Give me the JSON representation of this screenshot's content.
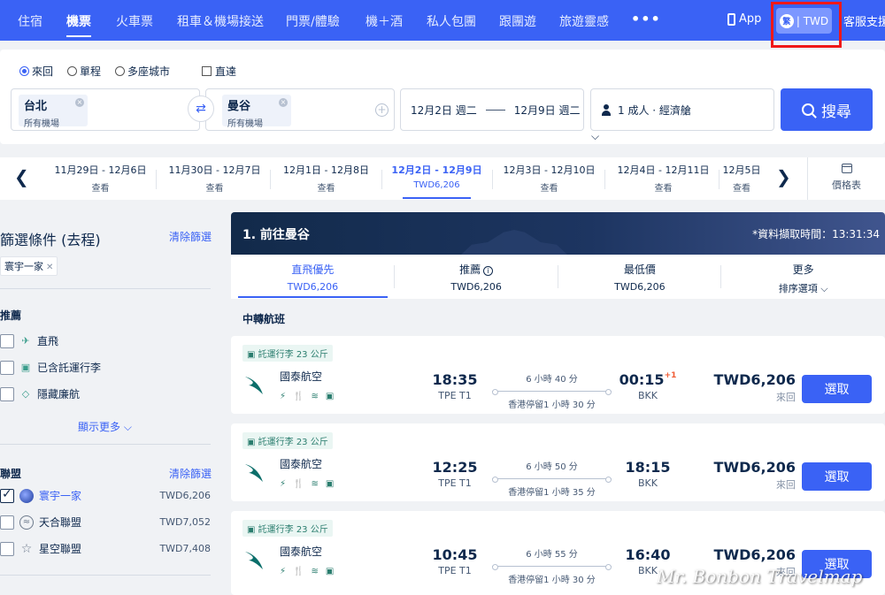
{
  "nav": {
    "items": [
      "住宿",
      "機票",
      "火車票",
      "租車＆機場接送",
      "門票/體驗",
      "機＋酒",
      "私人包團",
      "跟團遊",
      "旅遊靈感"
    ],
    "active_index": 1,
    "more_icon": "•••",
    "app_label": "App",
    "lang_badge": "繁",
    "currency_label": "| TWD",
    "support_label": "客服支援"
  },
  "search": {
    "trip_types": [
      "來回",
      "單程",
      "多座城市"
    ],
    "selected_trip_type": "來回",
    "direct_label": "直達",
    "origin": {
      "city": "台北",
      "sub": "所有機場"
    },
    "destination": {
      "city": "曼谷",
      "sub": "所有機場"
    },
    "depart_date": "12月2日 週二",
    "return_date": "12月9日 週二",
    "passengers": "1 成人 · 經濟艙",
    "search_label": "搜尋"
  },
  "date_strip": {
    "cells": [
      {
        "dates": "11月29日 - 12月6日",
        "price": "查看"
      },
      {
        "dates": "11月30日 - 12月7日",
        "price": "查看"
      },
      {
        "dates": "12月1日 - 12月8日",
        "price": "查看"
      },
      {
        "dates": "12月2日 - 12月9日",
        "price": "TWD6,206"
      },
      {
        "dates": "12月3日 - 12月10日",
        "price": "查看"
      },
      {
        "dates": "12月4日 - 12月11日",
        "price": "查看"
      },
      {
        "dates": "12月5日",
        "price": "查看"
      }
    ],
    "active_index": 3,
    "price_table_label": "價格表"
  },
  "sidebar": {
    "title": "篩選條件 (去程)",
    "clear_label": "清除篩選",
    "applied_tag": "寰宇一家",
    "recommended_heading": "推薦",
    "recommended": [
      {
        "label": "直飛",
        "icon": "plane-icon"
      },
      {
        "label": "已含託運行李",
        "icon": "luggage-icon"
      },
      {
        "label": "隱藏廉航",
        "icon": "tag-icon"
      }
    ],
    "show_more": "顯示更多",
    "alliance_heading": "聯盟",
    "alliance_clear": "清除篩選",
    "alliances": [
      {
        "label": "寰宇一家",
        "price": "TWD6,206",
        "checked": true,
        "color": "#3a62f5"
      },
      {
        "label": "天合聯盟",
        "price": "TWD7,052",
        "checked": false,
        "color": "#6d7a8c"
      },
      {
        "label": "星空聯盟",
        "price": "TWD7,408",
        "checked": false,
        "color": "#6d7a8c"
      }
    ]
  },
  "results": {
    "banner_title": "1. 前往曼谷",
    "fetch_time": "*資料擷取時間：13:31:34",
    "sort_tabs": [
      {
        "name": "直飛優先",
        "value": "TWD6,206"
      },
      {
        "name": "推薦",
        "value": "TWD6,206"
      },
      {
        "name": "最低價",
        "value": "TWD6,206"
      },
      {
        "name": "更多",
        "value": "排序選項"
      }
    ],
    "section_label": "中轉航班",
    "flights": [
      {
        "bag": "託運行李 23 公斤",
        "airline": "國泰航空",
        "dep_time": "18:35",
        "dep_airport": "TPE T1",
        "duration": "6 小時 40 分",
        "stop": "香港停留1 小時 30 分",
        "arr_time": "00:15",
        "arr_plus": "+1",
        "arr_airport": "BKK",
        "price": "TWD6,206",
        "trip": "來回",
        "select": "選取"
      },
      {
        "bag": "託運行李 23 公斤",
        "airline": "國泰航空",
        "dep_time": "12:25",
        "dep_airport": "TPE T1",
        "duration": "6 小時 50 分",
        "stop": "香港停留1 小時 35 分",
        "arr_time": "18:15",
        "arr_plus": "",
        "arr_airport": "BKK",
        "price": "TWD6,206",
        "trip": "來回",
        "select": "選取"
      },
      {
        "bag": "託運行李 23 公斤",
        "airline": "國泰航空",
        "dep_time": "10:45",
        "dep_airport": "TPE T1",
        "duration": "6 小時 55 分",
        "stop": "香港停留1 小時 30 分",
        "arr_time": "16:40",
        "arr_plus": "",
        "arr_airport": "BKK",
        "price": "TWD6,206",
        "trip": "來回",
        "select": "選取"
      }
    ]
  },
  "watermark": "Mr. Bonbon Travelmap",
  "colors": {
    "brand": "#3a62f5",
    "highlight_box": "#f01818",
    "amenity": "#2a7d6e",
    "cathay": "#0b6e6a"
  }
}
